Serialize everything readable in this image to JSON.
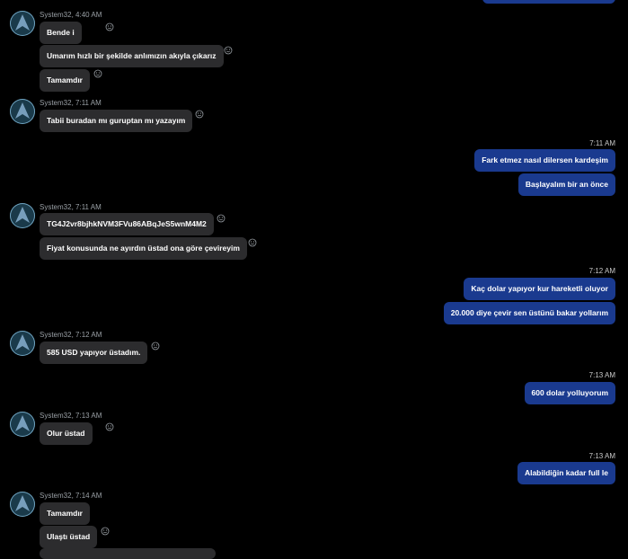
{
  "colors": {
    "background": "#000000",
    "incoming_bubble": "#2c2c2e",
    "outgoing_bubble": "#1a3a8f"
  },
  "groups": [
    {
      "sender": "System32",
      "time": "4:40 AM",
      "messages": [
        "Bende i",
        "Umarım hızlı bir şekilde anlımızın akıyla çıkarız",
        "Tamamdır"
      ]
    },
    {
      "sender": "System32",
      "time": "7:11 AM",
      "messages": [
        "Tabii buradan mı guruptan mı yazayım"
      ]
    },
    {
      "time": "7:11 AM",
      "outgoing": true,
      "messages": [
        "Fark etmez nasıl dilersen kardeşim",
        "Başlayalım bir an önce"
      ]
    },
    {
      "sender": "System32",
      "time": "7:11 AM",
      "messages": [
        "TG4J2vr8bjhkNVM3FVu86ABqJeS5wnM4M2",
        "Fiyat konusunda ne ayırdın üstad ona göre çevireyim"
      ]
    },
    {
      "time": "7:12 AM",
      "outgoing": true,
      "messages": [
        "Kaç dolar yapıyor kur hareketli oluyor",
        "20.000 diye çevir sen üstünü bakar yollarım"
      ]
    },
    {
      "sender": "System32",
      "time": "7:12 AM",
      "messages": [
        "585 USD yapıyor üstadım."
      ]
    },
    {
      "time": "7:13 AM",
      "outgoing": true,
      "messages": [
        "600 dolar yolluyorum"
      ]
    },
    {
      "sender": "System32",
      "time": "7:13 AM",
      "messages": [
        "Olur üstad"
      ]
    },
    {
      "time": "7:13 AM",
      "outgoing": true,
      "messages": [
        "Alabildiğin kadar full le"
      ]
    },
    {
      "sender": "System32",
      "time": "7:14 AM",
      "messages": [
        "Tamamdır",
        "Ulaştı üstad"
      ]
    }
  ]
}
